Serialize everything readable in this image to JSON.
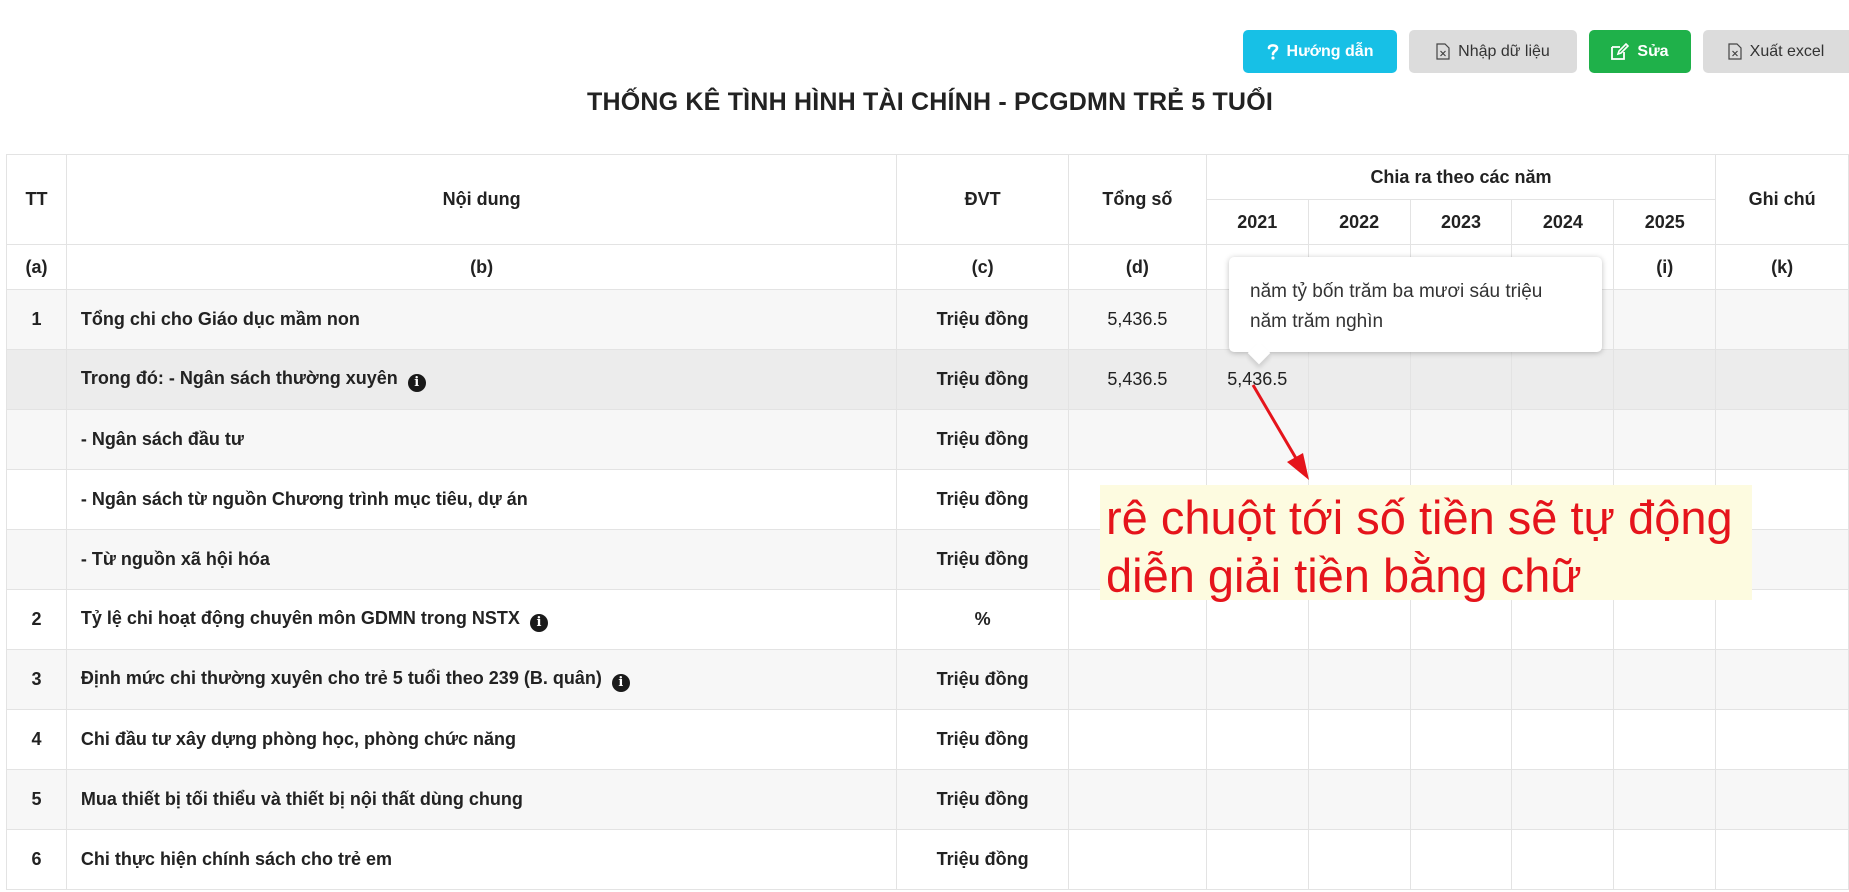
{
  "toolbar": {
    "guide_label": "Hướng dẫn",
    "import_label": "Nhập dữ liệu",
    "edit_label": "Sửa",
    "export_label": "Xuất excel",
    "guide_color": "#17c0e6",
    "edit_color": "#1fb14a",
    "icons": [
      "question-icon",
      "excel-file-icon",
      "edit-icon",
      "excel-file-icon"
    ]
  },
  "page_title": "THỐNG KÊ TÌNH HÌNH TÀI CHÍNH - PCGDMN TRẺ 5 TUỔI",
  "table": {
    "headers": {
      "tt": "TT",
      "content": "Nội dung",
      "unit": "ĐVT",
      "total": "Tổng số",
      "years_group": "Chia ra theo các năm",
      "years": [
        "2021",
        "2022",
        "2023",
        "2024",
        "2025"
      ],
      "note": "Ghi chú"
    },
    "codes": [
      "(a)",
      "(b)",
      "(c)",
      "(d)",
      "",
      "",
      "",
      "",
      "(i)",
      "(k)"
    ],
    "rows": [
      {
        "tt": "1",
        "content": "Tổng chi cho Giáo dục mầm non",
        "unit": "Triệu đồng",
        "total": "5,436.5",
        "y2021": ""
      },
      {
        "tt": "",
        "content": "Trong đó: - Ngân sách thường xuyên",
        "unit": "Triệu đồng",
        "total": "5,436.5",
        "y2021": "5,436.5",
        "info": true
      },
      {
        "tt": "",
        "content": "- Ngân sách đầu tư",
        "unit": "Triệu đồng",
        "total": "",
        "y2021": ""
      },
      {
        "tt": "",
        "content": "- Ngân sách từ nguồn Chương trình mục tiêu, dự án",
        "unit": "Triệu đồng",
        "total": "",
        "y2021": ""
      },
      {
        "tt": "",
        "content": "- Từ nguồn xã hội hóa",
        "unit": "Triệu đồng",
        "total": "",
        "y2021": ""
      },
      {
        "tt": "2",
        "content": "Tỷ lệ chi hoạt động chuyên môn GDMN trong NSTX",
        "unit": "%",
        "total": "",
        "y2021": "",
        "info": true
      },
      {
        "tt": "3",
        "content": "Định mức chi thường xuyên cho trẻ 5 tuổi theo 239 (B. quân)",
        "unit": "Triệu đồng",
        "total": "",
        "y2021": "",
        "info": true
      },
      {
        "tt": "4",
        "content": "Chi đầu tư xây dựng phòng học, phòng chức năng",
        "unit": "Triệu đồng",
        "total": "",
        "y2021": ""
      },
      {
        "tt": "5",
        "content": "Mua thiết bị tối thiểu và thiết bị nội thất dùng chung",
        "unit": "Triệu đồng",
        "total": "",
        "y2021": ""
      },
      {
        "tt": "6",
        "content": "Chi thực hiện chính sách cho trẻ em",
        "unit": "Triệu đồng",
        "total": "",
        "y2021": ""
      }
    ]
  },
  "tooltip": {
    "line1": "năm tỷ bốn trăm ba mươi sáu triệu",
    "line2": "năm trăm nghìn"
  },
  "annotation": {
    "line1": "rê chuột tới số tiền sẽ tự động",
    "line2": "diễn giải tiền bằng chữ",
    "color": "#e5141b"
  }
}
